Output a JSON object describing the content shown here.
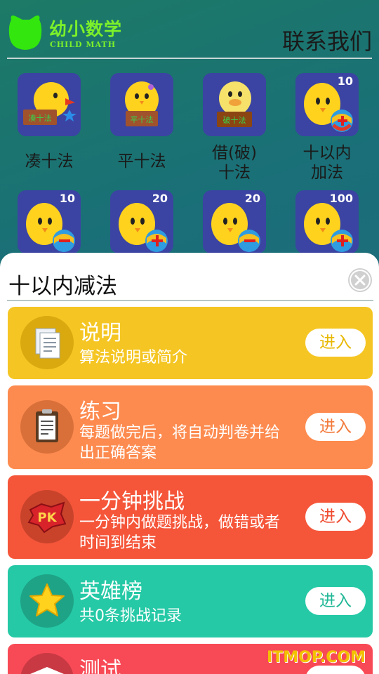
{
  "header": {
    "logo_title": "幼小数学",
    "logo_sub": "CHILD MATH",
    "contact": "联系我们"
  },
  "games": [
    {
      "label": "凑十法",
      "badge": "",
      "sign_text": "凑十法",
      "icon": "chick-with-sign-icon"
    },
    {
      "label": "平十法",
      "badge": "",
      "sign_text": "平十法",
      "icon": "chick-with-sign-icon"
    },
    {
      "label": "借(破)\n十法",
      "badge": "",
      "sign_text": "破十法",
      "icon": "duck-with-sign-icon"
    },
    {
      "label": "十以内\n加法",
      "badge": "10",
      "icon": "chick-ball-plus-icon"
    },
    {
      "label": "",
      "badge": "10",
      "icon": "chick-ball-minus-icon"
    },
    {
      "label": "",
      "badge": "20",
      "icon": "chick-ball-plus-icon"
    },
    {
      "label": "",
      "badge": "20",
      "icon": "chick-ball-minus-icon"
    },
    {
      "label": "",
      "badge": "100",
      "icon": "chick-ball-plus-icon"
    }
  ],
  "sheet": {
    "title": "十以内减法",
    "cards": [
      {
        "title": "说明",
        "desc": "算法说明或简介",
        "button": "进入",
        "color": "#f5c623",
        "icon_bg": "#d9a90f",
        "btn_color": "#e8b800",
        "icon": "document-icon"
      },
      {
        "title": "练习",
        "desc": "每题做完后，将自动判卷并给出正确答案",
        "button": "进入",
        "color": "#fd8b4f",
        "icon_bg": "#d9703a",
        "btn_color": "#f27a3a",
        "icon": "clipboard-icon"
      },
      {
        "title": "一分钟挑战",
        "desc": "一分钟内做题挑战，做错或者时间到结束",
        "button": "进入",
        "color": "#f5563a",
        "icon_bg": "#c9432b",
        "btn_color": "#ef4a2e",
        "icon": "pk-icon"
      },
      {
        "title": "英雄榜",
        "desc": "共0条挑战记录",
        "button": "进入",
        "color": "#25c9a6",
        "icon_bg": "#1ea386",
        "btn_color": "#20b796",
        "icon": "star-icon"
      },
      {
        "title": "测试",
        "desc": "",
        "button": "",
        "color": "#f84a56",
        "icon_bg": "#c93944",
        "btn_color": "#f84a56",
        "icon": "cap-icon"
      }
    ]
  },
  "watermark": "ITMOP.COM"
}
